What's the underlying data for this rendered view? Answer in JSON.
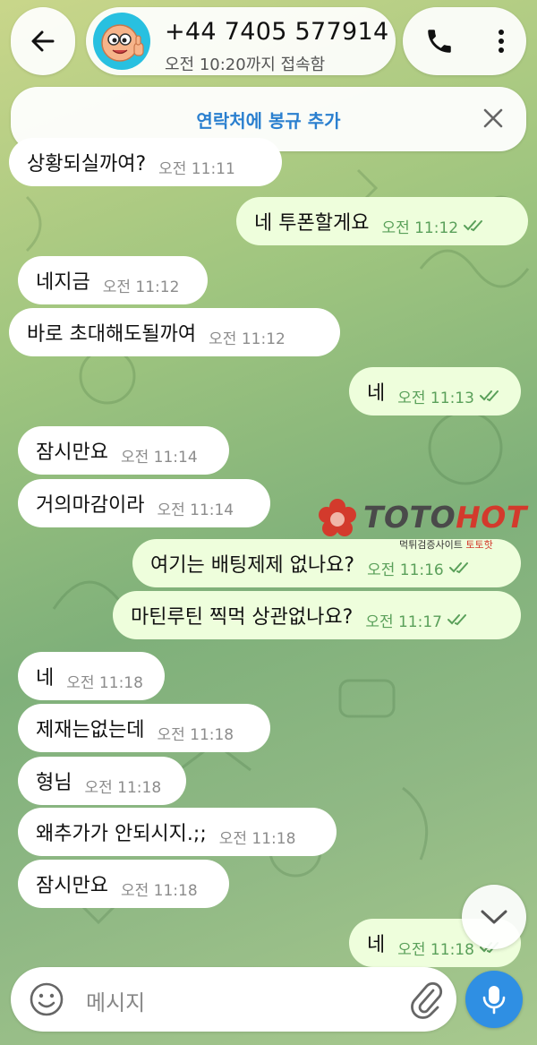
{
  "header": {
    "contact_name": "+44 7405 577914",
    "contact_status": "오전 10:20까지 접속함",
    "avatar_icon": "cartoon-face-icon"
  },
  "banner": {
    "text": "연락처에 봉규 추가",
    "close_icon": "close-icon"
  },
  "messages": [
    {
      "dir": "in",
      "text": "상황되실까여?",
      "time": "오전 11:11"
    },
    {
      "dir": "out",
      "text": "네 투폰할게요",
      "time": "오전 11:12",
      "read": true
    },
    {
      "dir": "in",
      "text": "네지금",
      "time": "오전 11:12"
    },
    {
      "dir": "in",
      "text": "바로 초대해도될까여",
      "time": "오전 11:12"
    },
    {
      "dir": "out",
      "text": "네",
      "time": "오전 11:13",
      "read": true
    },
    {
      "dir": "in",
      "text": "잠시만요",
      "time": "오전 11:14"
    },
    {
      "dir": "in",
      "text": "거의마감이라",
      "time": "오전 11:14"
    },
    {
      "dir": "out",
      "text": "여기는 배팅제제 없나요?",
      "time": "오전 11:16",
      "read": true
    },
    {
      "dir": "out",
      "text": "마틴루틴 찍먹 상관없나요?",
      "time": "오전 11:17",
      "read": true
    },
    {
      "dir": "in",
      "text": "네",
      "time": "오전 11:18"
    },
    {
      "dir": "in",
      "text": "제재는없는데",
      "time": "오전 11:18"
    },
    {
      "dir": "in",
      "text": "형님",
      "time": "오전 11:18"
    },
    {
      "dir": "in",
      "text": "왜추가가 안되시지.;;",
      "time": "오전 11:18"
    },
    {
      "dir": "in",
      "text": "잠시만요",
      "time": "오전 11:18"
    },
    {
      "dir": "out",
      "text": "네",
      "time": "오전 11:18",
      "read": true
    }
  ],
  "watermark": {
    "brand_a": "TOTO",
    "brand_b": "HOT",
    "sub_a": "먹튀검증사이트 ",
    "sub_b": "토토핫"
  },
  "input": {
    "placeholder": "메시지"
  },
  "colors": {
    "accent": "#2f8fe3",
    "incoming_bubble": "#ffffff",
    "outgoing_bubble": "#eefedc",
    "outgoing_time": "#5aa05a",
    "banner_text": "#2a7fcf"
  }
}
